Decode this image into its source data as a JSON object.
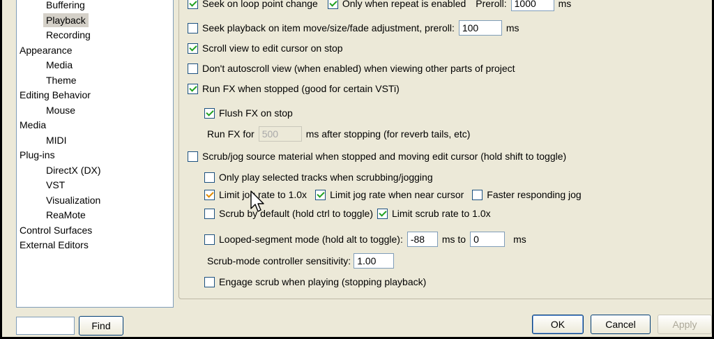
{
  "tree": {
    "items": [
      {
        "label": "Buffering",
        "indent": 1
      },
      {
        "label": "Playback",
        "indent": 1,
        "selected": true
      },
      {
        "label": "Recording",
        "indent": 1
      },
      {
        "label": "Appearance",
        "indent": 0
      },
      {
        "label": "Media",
        "indent": 1
      },
      {
        "label": "Theme",
        "indent": 1
      },
      {
        "label": "Editing Behavior",
        "indent": 0
      },
      {
        "label": "Mouse",
        "indent": 1
      },
      {
        "label": "Media",
        "indent": 0
      },
      {
        "label": "MIDI",
        "indent": 1
      },
      {
        "label": "Plug-ins",
        "indent": 0
      },
      {
        "label": "DirectX  (DX)",
        "indent": 1
      },
      {
        "label": "VST",
        "indent": 1
      },
      {
        "label": "Visualization",
        "indent": 1
      },
      {
        "label": "ReaMote",
        "indent": 1
      },
      {
        "label": "Control Surfaces",
        "indent": 0
      },
      {
        "label": "External Editors",
        "indent": 0
      }
    ]
  },
  "settings": {
    "top_cut": {
      "seek_loop_label": "Seek on loop point change",
      "only_repeat_label": "Only when repeat is enabled",
      "preroll_label": "Preroll:",
      "preroll_value": "1000",
      "ms": "ms"
    },
    "seek_item_label": "Seek playback on item move/size/fade adjustment, preroll:",
    "seek_item_value": "100",
    "ms": "ms",
    "scroll_view_label": "Scroll view to edit cursor on stop",
    "dont_autoscroll_label": "Don't autoscroll view (when enabled) when viewing other parts of project",
    "run_fx_label": "Run FX when stopped (good for certain VSTi)",
    "flush_fx_label": "Flush FX on stop",
    "run_fx_for_label": "Run FX for",
    "run_fx_for_value": "500",
    "run_fx_after_label": "ms after stopping (for reverb tails, etc)",
    "scrub_jog_label": "Scrub/jog source material when stopped and moving edit cursor (hold shift to toggle)",
    "only_selected_label": "Only play selected tracks when scrubbing/jogging",
    "limit_jog_label": "Limit jog rate to 1.0x",
    "limit_jog_near_label": "Limit jog rate when near cursor",
    "faster_jog_label": "Faster responding jog",
    "scrub_default_label": "Scrub by default (hold ctrl to toggle)",
    "limit_scrub_label": "Limit scrub rate to 1.0x",
    "looped_segment_label": "Looped-segment mode (hold alt to toggle):",
    "looped_from_value": "-88",
    "ms_to_label": "ms to",
    "looped_to_value": "0",
    "sensitivity_label": "Scrub-mode controller sensitivity:",
    "sensitivity_value": "1.00",
    "engage_scrub_label": "Engage scrub when playing (stopping playback)"
  },
  "footer": {
    "find_label": "Find",
    "ok_label": "OK",
    "cancel_label": "Cancel",
    "apply_label": "Apply"
  },
  "colors": {
    "check_green": "#21a121",
    "check_orange": "#e08a00",
    "window_bg": "#ece9d8"
  }
}
